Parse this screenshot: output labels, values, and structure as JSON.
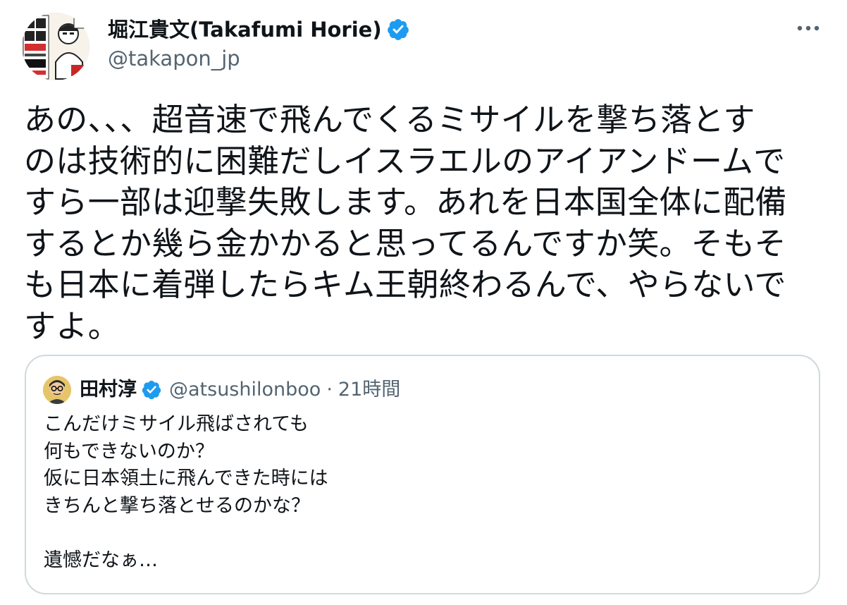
{
  "tweet": {
    "author": {
      "name": "堀江貴文(Takafumi Horie)",
      "handle": "@takapon_jp",
      "verified": true,
      "avatar_icon": "book-cover-avatar"
    },
    "more_icon": "more-dots-icon",
    "text": "あの、、、超音速で飛んでくるミサイルを撃ち落とす\nのは技術的に困難だしイスラエルのアイアンドームで\nすら一部は迎撃失敗します。あれを日本国全体に配備\nするとか幾ら金かかると思ってるんですか笑。そもそ\nも日本に着弾したらキム王朝終わるんで、やらないで\nすよ。"
  },
  "quote": {
    "author": {
      "name": "田村淳",
      "handle": "@atsushilonboo",
      "separator": "·",
      "time": "21時間",
      "verified": true,
      "avatar_icon": "person-avatar"
    },
    "text": "こんだけミサイル飛ばされても\n何もできないのか？\n仮に日本領土に飛んできた時には\nきちんと撃ち落とせるのかな？\n\n遺憾だなぁ…"
  },
  "colors": {
    "text_primary": "#0f1419",
    "text_secondary": "#536471",
    "verified_blue": "#1d9bf0",
    "card_border": "#cfd9de",
    "background": "#ffffff"
  }
}
